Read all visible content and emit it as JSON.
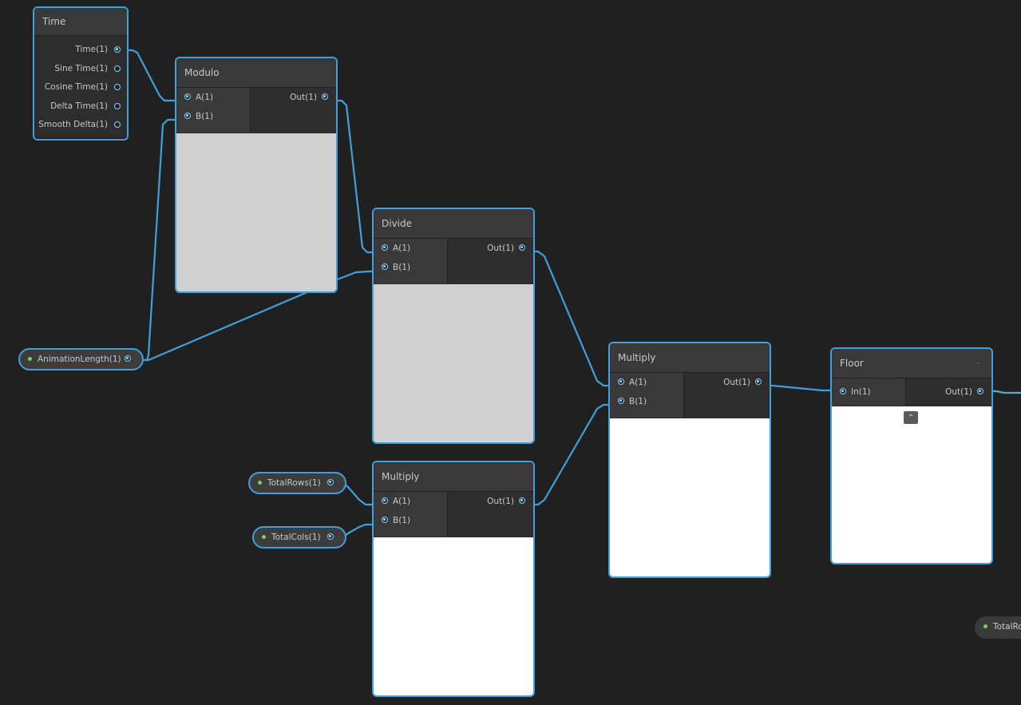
{
  "nodes": {
    "time": {
      "title": "Time",
      "outputs": [
        "Time(1)",
        "Sine Time(1)",
        "Cosine Time(1)",
        "Delta Time(1)",
        "Smooth Delta(1)"
      ]
    },
    "modulo": {
      "title": "Modulo",
      "inputs": [
        "A(1)",
        "B(1)"
      ],
      "output": "Out(1)"
    },
    "divide": {
      "title": "Divide",
      "inputs": [
        "A(1)",
        "B(1)"
      ],
      "output": "Out(1)"
    },
    "multiply_rows_cols": {
      "title": "Multiply",
      "inputs": [
        "A(1)",
        "B(1)"
      ],
      "output": "Out(1)"
    },
    "multiply_main": {
      "title": "Multiply",
      "inputs": [
        "A(1)",
        "B(1)"
      ],
      "output": "Out(1)"
    },
    "floor": {
      "title": "Floor",
      "inputs": [
        "In(1)"
      ],
      "output": "Out(1)"
    }
  },
  "properties": {
    "animation_length": "AnimationLength(1)",
    "total_rows": "TotalRows(1)",
    "total_cols": "TotalCols(1)",
    "total_rows_partial": "TotalRo"
  },
  "colors": {
    "canvas_bg": "#202020",
    "selection_outline": "#3fa0dc",
    "wire": "#3fa0dc",
    "float_port": "#8ed1f7",
    "property_dot": "#7fcf5a",
    "preview_grey": "#d0d0d0",
    "preview_white": "#ffffff"
  },
  "icons": {
    "floor_header": "chevron-down-icon",
    "floor_preview_toggle": "chevron-up-icon"
  }
}
